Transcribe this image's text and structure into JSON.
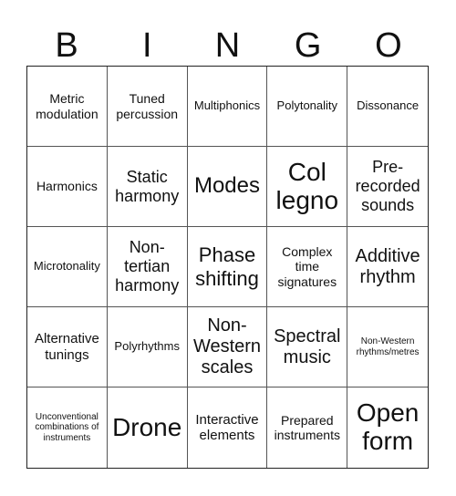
{
  "header": {
    "letters": [
      "B",
      "I",
      "N",
      "G",
      "O"
    ]
  },
  "cells": [
    "Metric modulation",
    "Tuned percussion",
    "Multiphonics",
    "Polytonality",
    "Dissonance",
    "Harmonics",
    "Static harmony",
    "Modes",
    "Col legno",
    "Pre-recorded sounds",
    "Microtonality",
    "Non-tertian harmony",
    "Phase shifting",
    "Complex time signatures",
    "Additive rhythm",
    "Alternative tunings",
    "Polyrhythms",
    "Non-Western scales",
    "Spectral music",
    "Non-Western rhythms/metres",
    "Unconventional combinations of instruments",
    "Drone",
    "Interactive elements",
    "Prepared instruments",
    "Open form"
  ]
}
